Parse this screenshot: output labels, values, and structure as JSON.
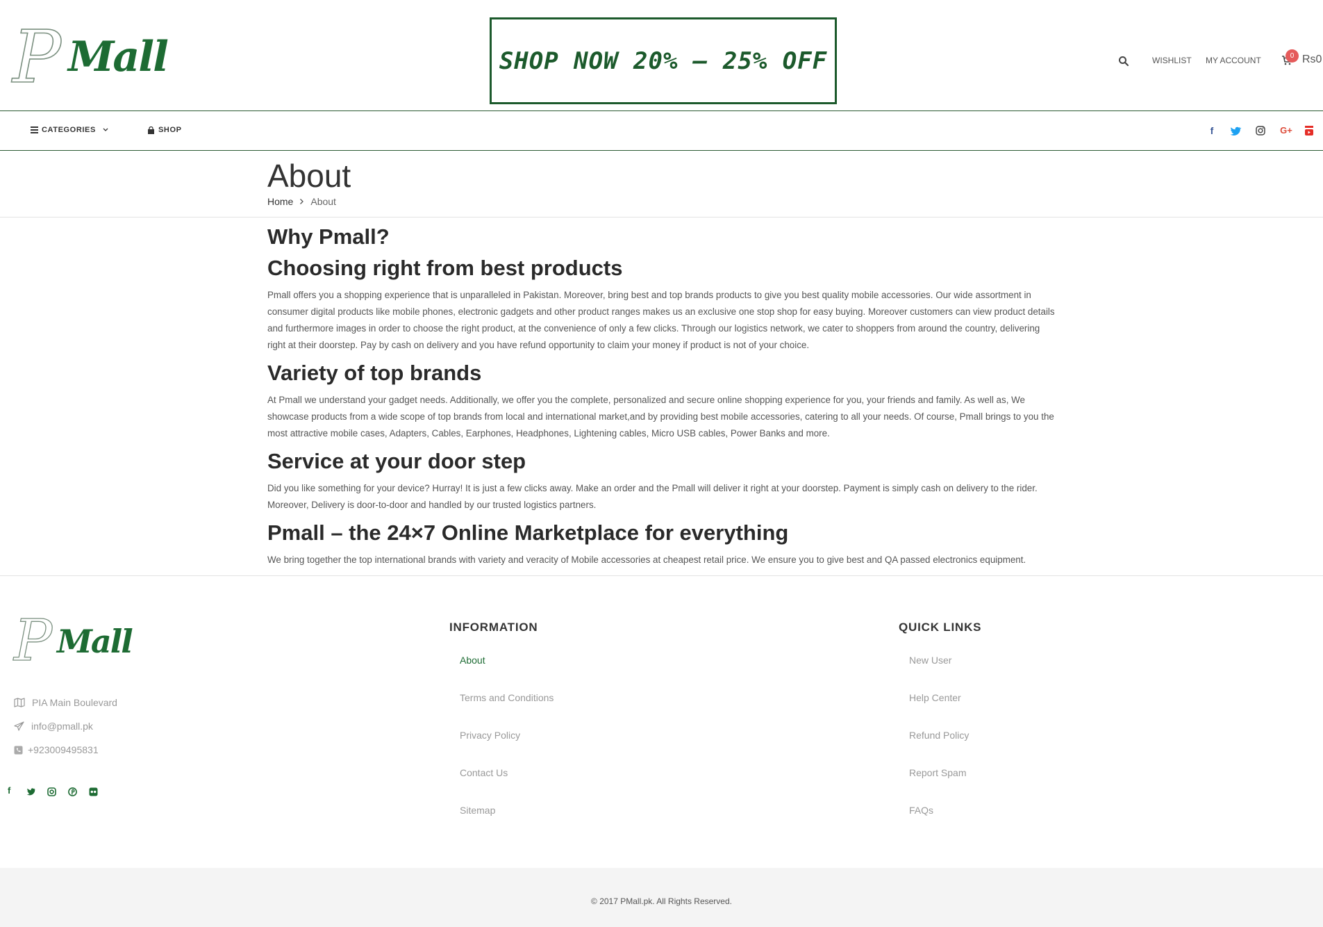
{
  "header": {
    "logo_p": "P",
    "logo_mall": "Mall",
    "banner_text": "SHOP NOW 20% – 25% OFF",
    "wishlist": "WISHLIST",
    "my_account": "MY ACCOUNT",
    "cart_count": "0",
    "cart_total": "Rs0"
  },
  "nav": {
    "categories": "CATEGORIES",
    "shop": "SHOP",
    "social_icons": [
      "facebook-icon",
      "twitter-icon",
      "instagram-icon",
      "google-plus-icon",
      "youtube-icon"
    ]
  },
  "page": {
    "title": "About",
    "breadcrumb": {
      "home": "Home",
      "current": "About"
    }
  },
  "content": {
    "h1": "Why Pmall?",
    "sections": [
      {
        "heading": "Choosing right from best products",
        "text": "Pmall offers you a shopping experience that is unparalleled in Pakistan. Moreover, bring best and top brands products to give you best quality mobile accessories. Our wide assortment in consumer digital products like mobile phones, electronic gadgets and other product ranges makes us an exclusive one stop shop for easy buying. Moreover customers can view product details and furthermore images in order to choose the right product, at the convenience of only a few clicks. Through our logistics network, we cater to shoppers from around the country, delivering right at their doorstep. Pay by cash on delivery and you have refund opportunity to claim your money if product is not of your choice."
      },
      {
        "heading": "Variety of top brands",
        "text": "At Pmall we understand your gadget needs. Additionally, we offer you the complete, personalized and secure online shopping experience for you, your friends and family. As well as, We showcase products from a wide scope of top brands from local and international market,and by providing best mobile accessories, catering to all your needs. Of course, Pmall brings to you the most attractive mobile cases, Adapters, Cables, Earphones, Headphones, Lightening cables, Micro USB cables, Power Banks and more."
      },
      {
        "heading": "Service at your door step",
        "text": "Did you like something for your device? Hurray! It is just a few clicks away. Make an order and the Pmall will deliver it right at your doorstep. Payment is simply cash on delivery to the rider. Moreover, Delivery is door-to-door and handled by our trusted logistics partners."
      },
      {
        "heading": "Pmall – the 24×7 Online Marketplace for everything",
        "text": "We bring together the top international brands with variety and veracity of Mobile accessories at cheapest retail price. We ensure you to give best and QA passed electronics equipment."
      }
    ]
  },
  "footer": {
    "address": "PIA Main Boulevard",
    "email": "info@pmall.pk",
    "phone": "+923009495831",
    "social_icons": [
      "facebook-icon",
      "twitter-icon",
      "instagram-icon",
      "pinterest-icon",
      "flickr-icon"
    ],
    "information": {
      "title": "INFORMATION",
      "links": [
        "About",
        "Terms and Conditions",
        "Privacy Policy",
        "Contact Us",
        "Sitemap"
      ]
    },
    "quick_links": {
      "title": "QUICK LINKS",
      "links": [
        "New User",
        "Help Center",
        "Refund Policy",
        "Report Spam",
        "FAQs"
      ]
    },
    "copyright": "© 2017 PMall.pk. All Rights Reserved."
  },
  "colors": {
    "brand_green": "#1d6b33",
    "cart_badge": "#e55b5b",
    "twitter": "#1da1f2",
    "google_plus": "#dd4b39",
    "youtube": "#e52d27",
    "facebook": "#3b5998"
  }
}
